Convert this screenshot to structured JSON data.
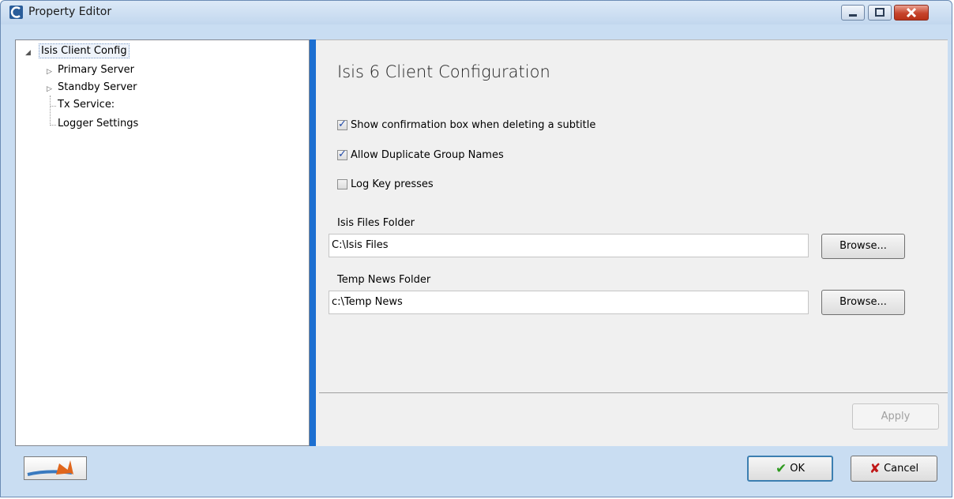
{
  "window": {
    "title": "Property Editor"
  },
  "tree": {
    "items": [
      {
        "label": "Isis Client Config",
        "expanded": true,
        "selected": true
      },
      {
        "label": "Primary Server",
        "expandable": true
      },
      {
        "label": "Standby Server",
        "expandable": true
      },
      {
        "label": "Tx Service:"
      },
      {
        "label": "Logger Settings"
      }
    ]
  },
  "panel": {
    "heading": "Isis 6 Client Configuration",
    "checkboxes": [
      {
        "label": "Show confirmation box when deleting a subtitle",
        "checked": true
      },
      {
        "label": "Allow Duplicate Group Names",
        "checked": true
      },
      {
        "label": "Log Key presses",
        "checked": false
      }
    ],
    "isis_files_label": "Isis Files Folder",
    "isis_files_value": "C:\\Isis Files",
    "temp_news_label": "Temp News Folder",
    "temp_news_value": "c:\\Temp News",
    "browse_label": "Browse...",
    "apply_label": "Apply"
  },
  "footer": {
    "ok_label": "OK",
    "cancel_label": "Cancel"
  },
  "colors": {
    "accent": "#1c6fd1",
    "close_button": "#c6432b"
  }
}
